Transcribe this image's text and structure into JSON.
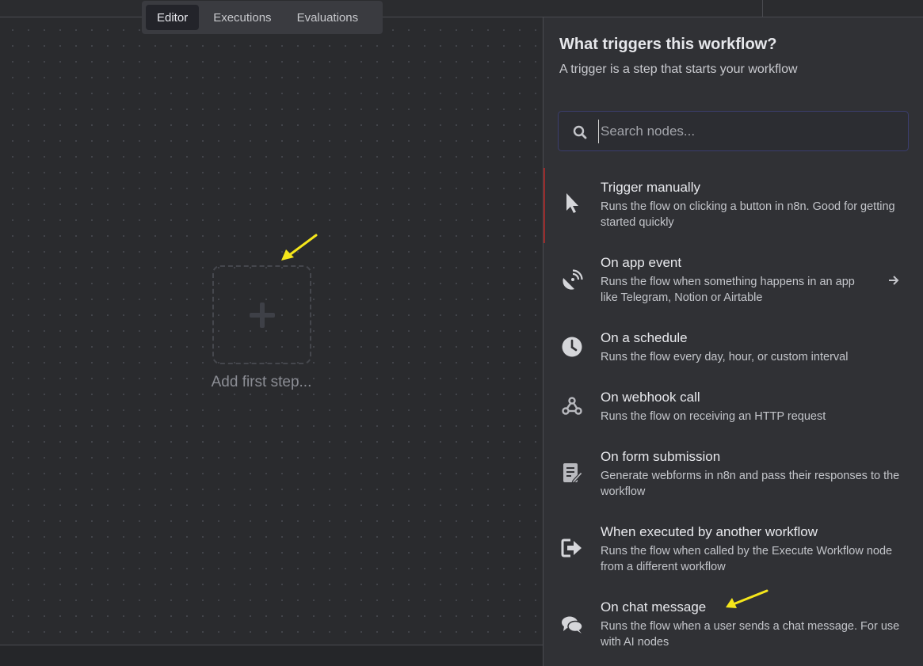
{
  "tabs": [
    {
      "label": "Editor",
      "active": true
    },
    {
      "label": "Executions",
      "active": false
    },
    {
      "label": "Evaluations",
      "active": false
    }
  ],
  "canvas": {
    "add_first_step_label": "Add first step..."
  },
  "panel": {
    "title": "What triggers this workflow?",
    "subtitle": "A trigger is a step that starts your workflow",
    "search_placeholder": "Search nodes...",
    "items": [
      {
        "title": "Trigger manually",
        "desc": "Runs the flow on clicking a button in n8n. Good for getting started quickly",
        "icon": "cursor-icon"
      },
      {
        "title": "On app event",
        "desc": "Runs the flow when something happens in an app like Telegram, Notion or Airtable",
        "icon": "satellite-dish-icon"
      },
      {
        "title": "On a schedule",
        "desc": "Runs the flow every day, hour, or custom interval",
        "icon": "clock-icon"
      },
      {
        "title": "On webhook call",
        "desc": "Runs the flow on receiving an HTTP request",
        "icon": "webhook-icon"
      },
      {
        "title": "On form submission",
        "desc": "Generate webforms in n8n and pass their responses to the workflow",
        "icon": "form-icon"
      },
      {
        "title": "When executed by another workflow",
        "desc": "Runs the flow when called by the Execute Workflow node from a different workflow",
        "icon": "sign-in-icon"
      },
      {
        "title": "On chat message",
        "desc": "Runs the flow when a user sends a chat message. For use with AI nodes",
        "icon": "comments-icon"
      }
    ]
  },
  "colors": {
    "canvas_bg": "#2a2b2e",
    "panel_bg": "#303135",
    "selected_marker": "#9a2a2a",
    "annotation_arrow": "#f5e61b"
  }
}
